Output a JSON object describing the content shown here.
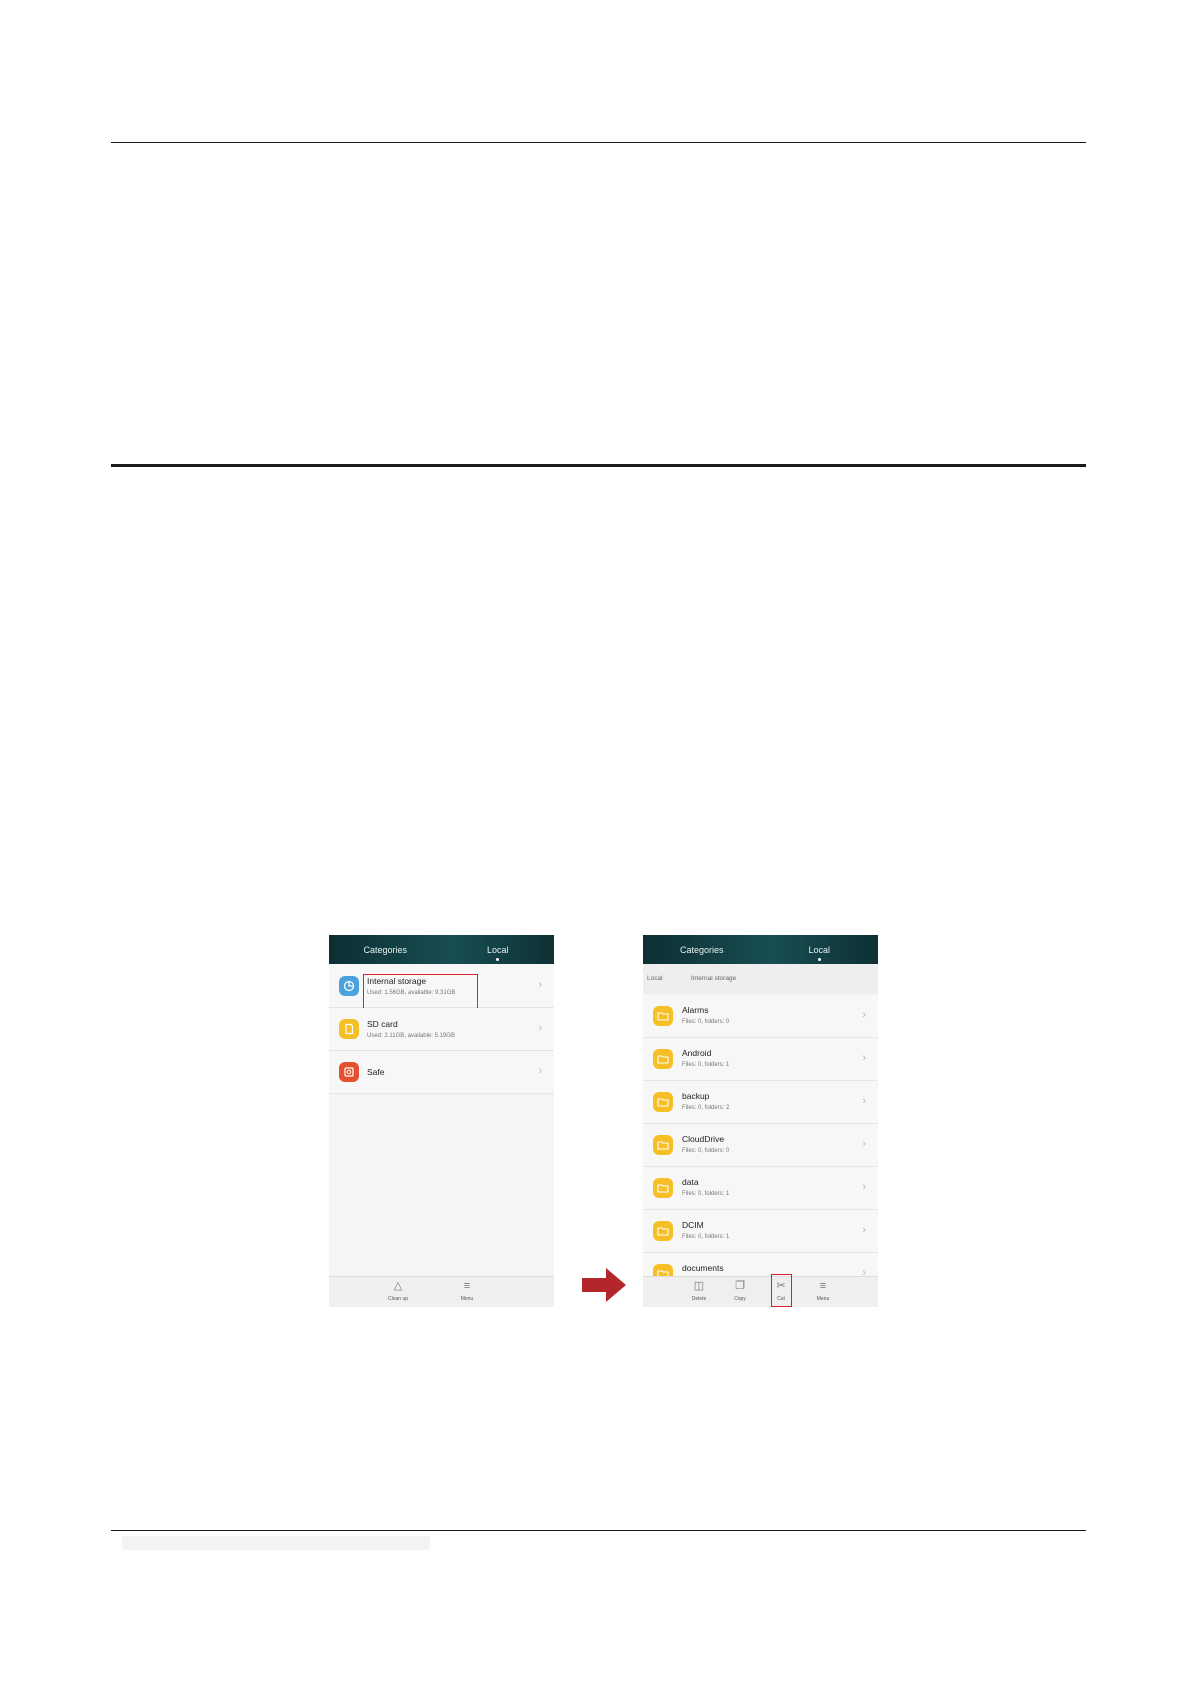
{
  "colors": {
    "accent": "#174e52",
    "highlight": "#d1242b",
    "folder": "#f6bf26",
    "storage_icon": "#4aa3df",
    "sd_icon": "#f6bf26",
    "safe_icon": "#e2502f",
    "arrow": "#b3262b"
  },
  "left_screen": {
    "tabs": [
      "Categories",
      "Local"
    ],
    "items": [
      {
        "title": "Internal storage",
        "subtitle": "Used: 1.56GB, available: 9.31GB",
        "icon": "pie-chart-icon"
      },
      {
        "title": "SD card",
        "subtitle": "Used: 2.11GB, available: 5.19GB",
        "icon": "sd-card-icon"
      },
      {
        "title": "Safe",
        "subtitle": "",
        "icon": "safe-icon"
      }
    ],
    "bottom": [
      {
        "label": "Clean up",
        "icon": "broom-icon"
      },
      {
        "label": "Menu",
        "icon": "menu-icon"
      }
    ]
  },
  "right_screen": {
    "tabs": [
      "Categories",
      "Local"
    ],
    "breadcrumb": [
      "Local",
      "Internal storage"
    ],
    "folders": [
      {
        "name": "Alarms",
        "info": "Files: 0, folders: 0"
      },
      {
        "name": "Android",
        "info": "Files: 0, folders: 1"
      },
      {
        "name": "backup",
        "info": "Files: 0, folders: 2"
      },
      {
        "name": "CloudDrive",
        "info": "Files: 0, folders: 0"
      },
      {
        "name": "data",
        "info": "Files: 0, folders: 1"
      },
      {
        "name": "DCIM",
        "info": "Files: 0, folders: 1"
      },
      {
        "name": "documents",
        "info": ""
      }
    ],
    "bottom": [
      {
        "label": "Delete",
        "icon": "trash-icon"
      },
      {
        "label": "Copy",
        "icon": "copy-icon"
      },
      {
        "label": "Cut",
        "icon": "scissors-icon"
      },
      {
        "label": "Menu",
        "icon": "menu-icon"
      }
    ]
  }
}
